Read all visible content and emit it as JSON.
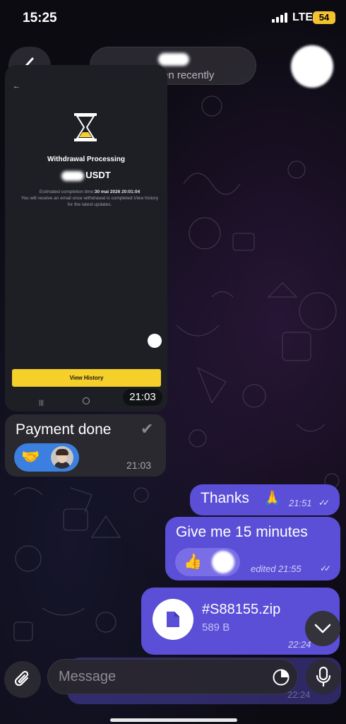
{
  "status_bar": {
    "time": "15:25",
    "network": "LTE",
    "battery": "54"
  },
  "header": {
    "subtitle": "last seen recently"
  },
  "messages": {
    "image_message": {
      "withdrawal_title": "Withdrawal Processing",
      "currency": "USDT",
      "estimated_label": "Estimated completion time:",
      "estimated_time": "30 mai 2026 20:01:04",
      "info_text": "You will receive an email once withdrawal is completed.View history for the latest updates.",
      "view_history_button": "View History",
      "time": "21:03"
    },
    "payment_done": {
      "text": "Payment done",
      "time": "21:03"
    },
    "thanks": {
      "text": "Thanks",
      "time": "21:51"
    },
    "give_me": {
      "text": "Give me 15 minutes",
      "time": "edited 21:55"
    },
    "file": {
      "name": "#S88155.zip",
      "size": "589 B",
      "time": "22:24"
    },
    "ghost": {
      "time": "22:24"
    }
  },
  "input": {
    "placeholder": "Message"
  },
  "colors": {
    "outgoing_bubble": "#5a4fd6",
    "incoming_bubble": "#2a2930",
    "accent_yellow": "#f5cf2a",
    "reaction_blue": "#3b7fe0"
  },
  "icons": [
    "back-icon",
    "hourglass-icon",
    "support-icon",
    "check-mark-icon",
    "handshake-icon",
    "folded-hands-icon",
    "thumbs-up-icon",
    "double-check-icon",
    "file-icon",
    "chevron-down-icon",
    "paperclip-icon",
    "sticker-icon",
    "microphone-icon"
  ]
}
